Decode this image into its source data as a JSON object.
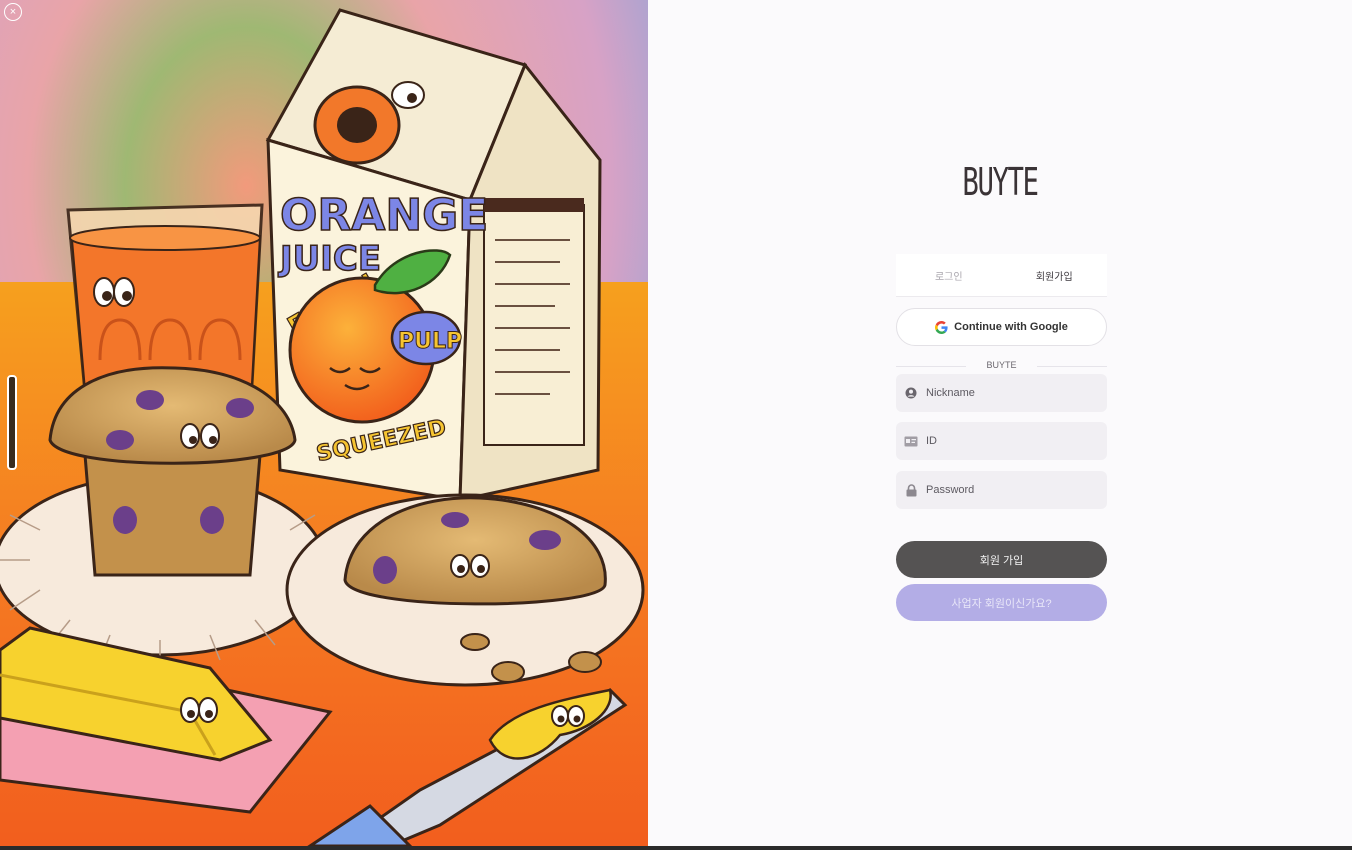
{
  "brand": {
    "logo": "BUYTE"
  },
  "tabs": [
    {
      "label": "로그인"
    },
    {
      "label": "회원가입"
    }
  ],
  "google": {
    "label": "Continue with Google",
    "icon": "google-icon"
  },
  "divider": {
    "label": "BUYTE"
  },
  "form": {
    "nickname": {
      "placeholder": "Nickname",
      "icon": "user-icon"
    },
    "id": {
      "placeholder": "ID",
      "icon": "id-card-icon"
    },
    "password": {
      "placeholder": "Password",
      "icon": "lock-icon"
    }
  },
  "buttons": {
    "signup": "회원 가입",
    "business": "사업자 회원이신가요?"
  },
  "art": {
    "carton_text": [
      "ORANGE",
      "JUICE",
      "FRESH",
      "PULP",
      "SQUEEZED"
    ]
  },
  "colors": {
    "primary_button": "#555353",
    "secondary_button": "#b3ade6",
    "panel_bg": "#fbfafc"
  }
}
